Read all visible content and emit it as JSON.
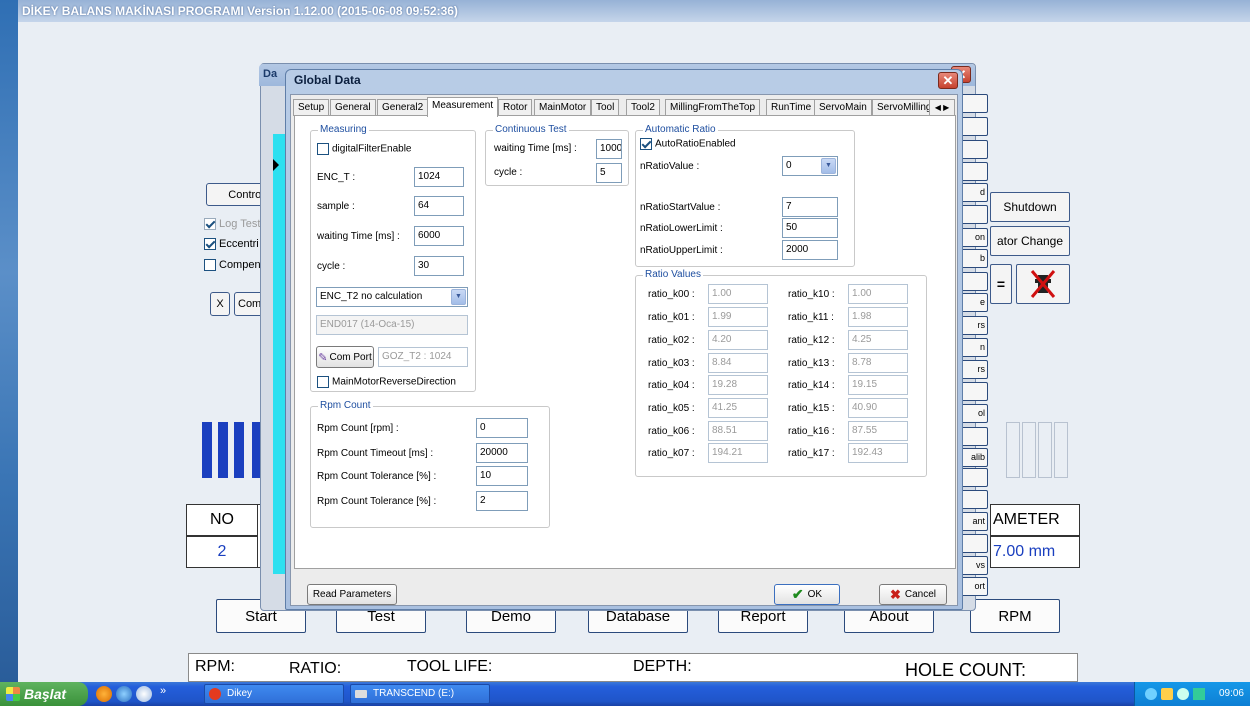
{
  "app": {
    "title": "DİKEY BALANS MAKİNASI PROGRAMI Version 1.12.00 (2015-06-08 09:52:36)",
    "control_button": "Control",
    "log_test": "Log Test",
    "eccentric": "Eccentri",
    "compensate": "Compens",
    "x_button": "X",
    "com_button": "Com",
    "shutdown_button": "Shutdown",
    "operator_change_button": "ator Change",
    "no_label": "NO",
    "no_value": "2",
    "parameter_label": "AMETER",
    "parameter_value": "7.00 mm",
    "bottom_buttons": [
      "Start",
      "Test",
      "Demo",
      "Database",
      "Report",
      "About",
      "RPM"
    ],
    "footer": [
      "RPM:",
      "RATIO:",
      "TOOL LIFE:",
      "DEPTH:",
      "HOLE COUNT:"
    ],
    "right_stack_labels": [
      "",
      "",
      "",
      "",
      "d",
      "",
      "on",
      "b",
      "",
      "e",
      "rs",
      "n",
      "rs",
      "",
      "ol",
      "",
      "alib",
      "",
      "",
      "ant",
      "",
      "vs",
      "ort"
    ],
    "accent_color": "#1a3fbf"
  },
  "behind_dialog": {
    "title": "Da"
  },
  "dialog": {
    "title": "Global Data",
    "tabs": [
      "Setup",
      "General",
      "General2",
      "Measurement",
      "Rotor",
      "MainMotor",
      "Tool",
      "Tool2",
      "MillingFromTheTop",
      "RunTime",
      "ServoMain",
      "ServoMilling"
    ],
    "active_tab": "Measurement",
    "measuring": {
      "legend": "Measuring",
      "digital_filter": "digitalFilterEnable",
      "digital_filter_checked": false,
      "enc_t_label": "ENC_T :",
      "enc_t_value": "1024",
      "sample_label": "sample :",
      "sample_value": "64",
      "waiting_label": "waiting Time [ms] :",
      "waiting_value": "6000",
      "cycle_label": "cycle :",
      "cycle_value": "30",
      "calc_select": "ENC_T2 no calculation",
      "device_value": "END017 (14-Oca-15)",
      "com_port_button": "Com Port",
      "goz_value": "GOZ_T2 : 1024",
      "reverse_label": "MainMotorReverseDirection",
      "reverse_checked": false
    },
    "continuous": {
      "legend": "Continuous Test",
      "waiting_label": "waiting Time [ms] :",
      "waiting_value": "1000",
      "cycle_label": "cycle :",
      "cycle_value": "5"
    },
    "auto_ratio": {
      "legend": "Automatic Ratio",
      "enabled_label": "AutoRatioEnabled",
      "enabled_checked": true,
      "value_label": "nRatioValue :",
      "value": "0",
      "start_label": "nRatioStartValue :",
      "start_value": "7",
      "lower_label": "nRatioLowerLimit :",
      "lower_value": "50",
      "upper_label": "nRatioUpperLimit :",
      "upper_value": "2000"
    },
    "ratio_values": {
      "legend": "Ratio Values",
      "left": [
        {
          "label": "ratio_k00 :",
          "value": "1.00"
        },
        {
          "label": "ratio_k01 :",
          "value": "1.99"
        },
        {
          "label": "ratio_k02 :",
          "value": "4.20"
        },
        {
          "label": "ratio_k03 :",
          "value": "8.84"
        },
        {
          "label": "ratio_k04 :",
          "value": "19.28"
        },
        {
          "label": "ratio_k05 :",
          "value": "41.25"
        },
        {
          "label": "ratio_k06 :",
          "value": "88.51"
        },
        {
          "label": "ratio_k07 :",
          "value": "194.21"
        }
      ],
      "right": [
        {
          "label": "ratio_k10 :",
          "value": "1.00"
        },
        {
          "label": "ratio_k11 :",
          "value": "1.98"
        },
        {
          "label": "ratio_k12 :",
          "value": "4.25"
        },
        {
          "label": "ratio_k13 :",
          "value": "8.78"
        },
        {
          "label": "ratio_k14 :",
          "value": "19.15"
        },
        {
          "label": "ratio_k15 :",
          "value": "40.90"
        },
        {
          "label": "ratio_k16 :",
          "value": "87.55"
        },
        {
          "label": "ratio_k17 :",
          "value": "192.43"
        }
      ]
    },
    "rpm_count": {
      "legend": "Rpm Count",
      "rows": [
        {
          "label": "Rpm Count [rpm] :",
          "value": "0"
        },
        {
          "label": "Rpm Count Timeout [ms] :",
          "value": "20000"
        },
        {
          "label": "Rpm Count Tolerance [%] :",
          "value": "10"
        },
        {
          "label": "Rpm Count Tolerance [%] :",
          "value": "2"
        }
      ]
    },
    "read_parameters_button": "Read Parameters",
    "ok_button": "OK",
    "cancel_button": "Cancel"
  },
  "taskbar": {
    "start_label": "Başlat",
    "items": [
      "Dikey",
      "TRANSCEND (E:)"
    ],
    "clock": "09:06"
  }
}
